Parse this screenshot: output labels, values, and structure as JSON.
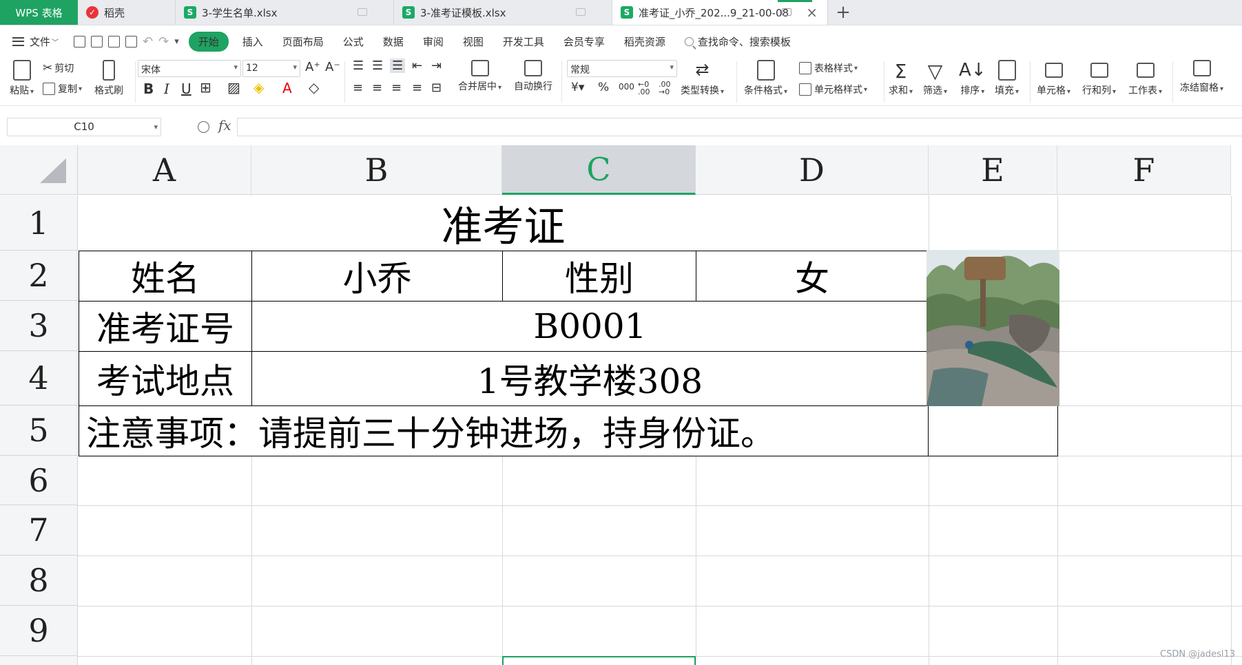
{
  "tabs": {
    "app": "WPS 表格",
    "items": [
      {
        "label": "稻壳",
        "icon": "daoke-icon"
      },
      {
        "label": "3-学生名单.xlsx",
        "icon": "sheet-icon"
      },
      {
        "label": "3-准考证模板.xlsx",
        "icon": "sheet-icon"
      },
      {
        "label": "准考证_小乔_202...9_21-00-08",
        "icon": "sheet-icon",
        "active": true
      }
    ]
  },
  "menu": {
    "file": "文件",
    "items": [
      "开始",
      "插入",
      "页面布局",
      "公式",
      "数据",
      "审阅",
      "视图",
      "开发工具",
      "会员专享",
      "稻壳资源"
    ],
    "search_placeholder": "查找命令、搜索模板"
  },
  "ribbon": {
    "paste": "粘贴",
    "cut": "剪切",
    "copy": "复制",
    "format_painter": "格式刷",
    "font_name": "宋体",
    "font_size": "12",
    "merge_center": "合并居中",
    "wrap_text": "自动换行",
    "number_format": "常规",
    "type_convert": "类型转换",
    "conditional_format": "条件格式",
    "table_style": "表格样式",
    "cell_style": "单元格样式",
    "sum": "求和",
    "filter": "筛选",
    "sort": "排序",
    "fill": "填充",
    "cell": "单元格",
    "row_col": "行和列",
    "worksheet": "工作表",
    "freeze": "冻结窗格"
  },
  "formula_bar": {
    "name_box": "C10",
    "fx": "fx",
    "content": ""
  },
  "grid": {
    "columns": [
      "A",
      "B",
      "C",
      "D",
      "E",
      "F"
    ],
    "selected_column": "C",
    "rows": [
      "1",
      "2",
      "3",
      "4",
      "5",
      "6",
      "7",
      "8",
      "9"
    ]
  },
  "ticket": {
    "title": "准考证",
    "name_label": "姓名",
    "name_value": "小乔",
    "gender_label": "性别",
    "gender_value": "女",
    "id_label": "准考证号",
    "id_value": "B0001",
    "location_label": "考试地点",
    "location_value": "1号教学楼308",
    "notice": "注意事项：请提前三十分钟进场，持身份证。"
  },
  "watermark": "CSDN @jadesl13"
}
